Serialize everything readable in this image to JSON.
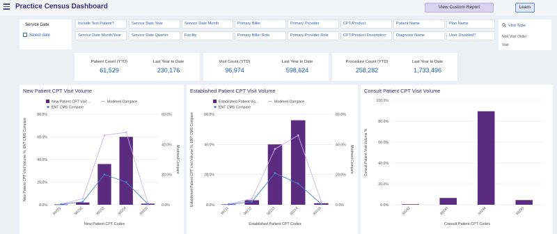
{
  "header": {
    "title": "Practice Census Dashboard",
    "view_custom_report": "View Custom Report",
    "learn": "Learn"
  },
  "service_date": {
    "label": "Service Date",
    "select": "Select date"
  },
  "filters": [
    "Include Test Patient?",
    "Service Date Year",
    "Service Date Month",
    "Primary Biller",
    "Primary Provider",
    "CPT/Product",
    "Patient Name",
    "Plan Name",
    "Service Date Month/Year",
    "Service Date Quarter",
    "Facility",
    "Primary Biller Role",
    "Primary Provider Role",
    "CPT/Product Description",
    "Diagnosis Name",
    "User Disabled?"
  ],
  "visit_type": {
    "header": "Visit Type",
    "items": [
      "Non Visit Order",
      "Visit"
    ]
  },
  "kpis": [
    {
      "label": "Patient Count (YTD)",
      "value": "61,529",
      "ly_label": "Last Year to Date",
      "ly_value": "230,176"
    },
    {
      "label": "Visit Count (YTD)",
      "value": "96,974",
      "ly_label": "Last Year to Date",
      "ly_value": "598,624"
    },
    {
      "label": "Procedure Count (YTD)",
      "value": "258,282",
      "ly_label": "Last Year to Date",
      "ly_value": "1,733,496"
    }
  ],
  "colors": {
    "bar": "#5b2b7f",
    "modmed": "#c9b3ef",
    "ent": "#4a86c5",
    "accent": "#3b2c7a"
  },
  "chart_data": [
    {
      "type": "bar",
      "title": "New Patient CPT Visit Volume",
      "legend": [
        "New Patient CPT Visit ...",
        "Modmed Compare",
        "ENT CMS Compare"
      ],
      "categories": [
        "99201",
        "99202",
        "99203",
        "99204",
        "99205"
      ],
      "series": [
        {
          "name": "New Patient CPT Visit ...",
          "type": "bar",
          "axis": "left",
          "values": [
            0.3,
            2.0,
            36.0,
            60.0,
            1.0
          ]
        },
        {
          "name": "Modmed Compare",
          "type": "line",
          "axis": "right",
          "values": [
            0.5,
            4.0,
            46.0,
            48.0,
            1.0
          ]
        },
        {
          "name": "ENT CMS Compare",
          "type": "line",
          "axis": "right",
          "values": [
            0.3,
            2.0,
            20.0,
            15.0,
            0.5
          ]
        }
      ],
      "ylim_left": [
        0,
        80
      ],
      "ylim_right": [
        0,
        60
      ],
      "ticks_left": [
        "0.0%",
        "20.0%",
        "40.0%",
        "60.0%",
        "80.0%"
      ],
      "ticks_right": [
        "0.0%",
        "20.0%",
        "40.0%",
        "60.0%"
      ],
      "ylabel_left": "New Patient CPT Visit Volume %, ENT CMS Compare",
      "ylabel_right": "Modmed Compare",
      "xlabel": "New Patient CPT Codes"
    },
    {
      "type": "bar",
      "title": "Established Patient CPT Visit Volume",
      "legend": [
        "Established Patient Vis...",
        "Modmed Compare",
        "ENT CMS Compare"
      ],
      "categories": [
        "99211",
        "99212",
        "99213",
        "99214",
        "99215"
      ],
      "series": [
        {
          "name": "Established Patient Vis...",
          "type": "bar",
          "axis": "left",
          "values": [
            0.3,
            3.0,
            40.0,
            56.0,
            1.0
          ]
        },
        {
          "name": "Modmed Compare",
          "type": "line",
          "axis": "right",
          "values": [
            0.5,
            4.0,
            37.0,
            46.0,
            2.0
          ]
        },
        {
          "name": "ENT CMS Compare",
          "type": "line",
          "axis": "right",
          "values": [
            0.3,
            2.0,
            21.0,
            14.0,
            0.5
          ]
        }
      ],
      "ylim_left": [
        0,
        60
      ],
      "ylim_right": [
        0,
        60
      ],
      "ticks_left": [
        "0.0%",
        "20.0%",
        "40.0%",
        "60.0%"
      ],
      "ticks_right": [
        "0.0%",
        "20.0%",
        "40.0%",
        "60.0%"
      ],
      "ylabel_left": "Established Patient CPT Visit Volume %, ENT CMS Compare",
      "ylabel_right": "Modmed Compare",
      "xlabel": "Established Patient CPT Codes"
    },
    {
      "type": "bar",
      "title": "Consult Patient CPT Visit Volume",
      "legend": [],
      "categories": [
        "99242",
        "99243",
        "99244",
        "99245"
      ],
      "series": [
        {
          "name": "",
          "type": "bar",
          "axis": "left",
          "values": [
            0.5,
            6.5,
            89.5,
            4.5
          ]
        }
      ],
      "ylim_left": [
        0,
        100
      ],
      "ticks_left": [
        "0.0%",
        "20.0%",
        "40.0%",
        "60.0%",
        "80.0%",
        "100.0%"
      ],
      "ylabel_left": "Consult Patient Visit Volume %",
      "xlabel": "Consult Patient CPT Codes"
    }
  ]
}
